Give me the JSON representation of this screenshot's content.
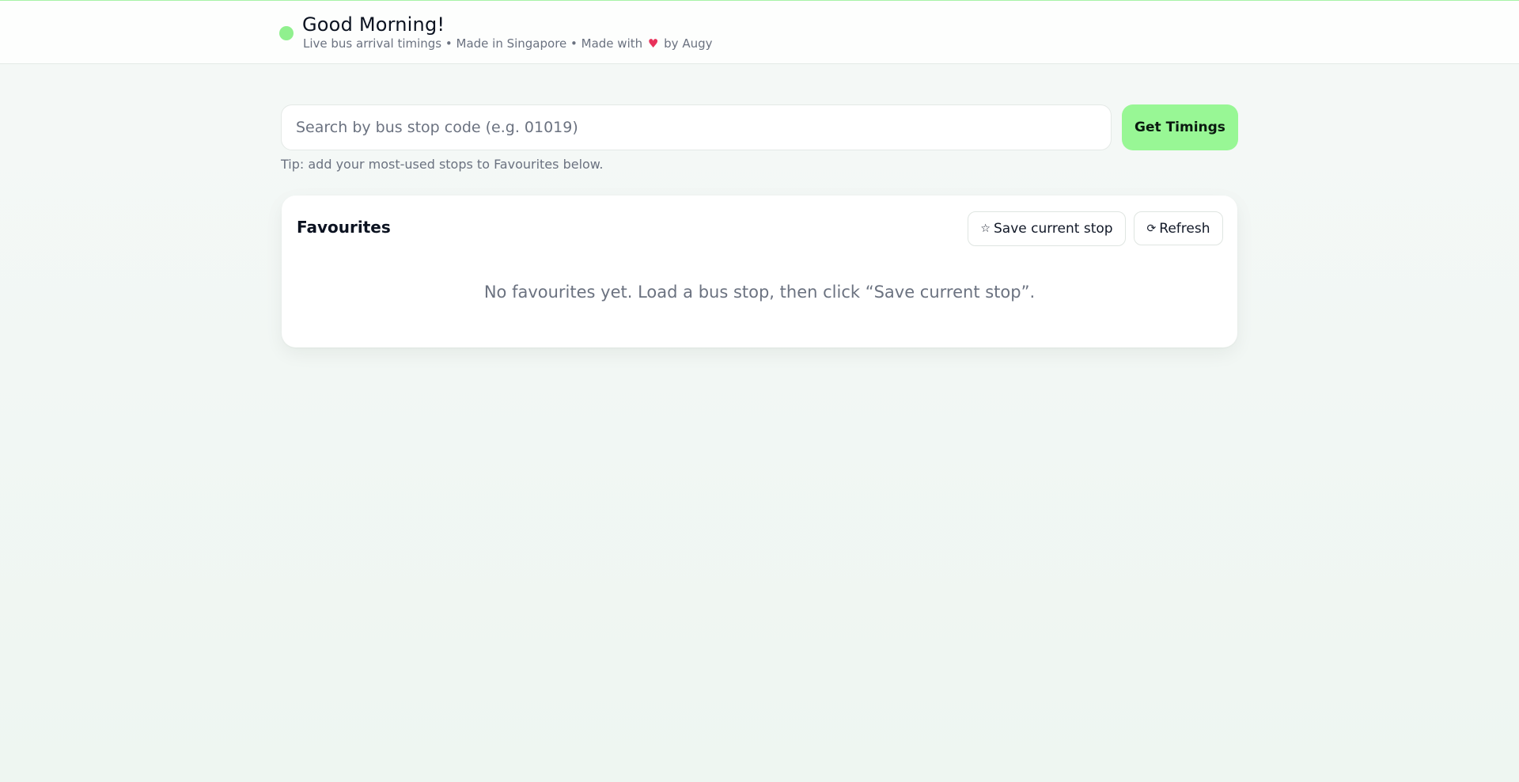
{
  "header": {
    "greeting": "Good Morning!",
    "subtitle_prefix": "Live bus arrival timings • Made in Singapore • Made with",
    "heart": "♥",
    "subtitle_suffix": "by Augy",
    "status_color": "#90f08e"
  },
  "search": {
    "placeholder": "Search by bus stop code (e.g. 01019)",
    "value": "",
    "button_label": "Get Timings",
    "tip": "Tip: add your most-used stops to Favourites below."
  },
  "favourites": {
    "title": "Favourites",
    "save_icon": "☆",
    "save_label": "Save current stop",
    "refresh_icon": "⟳",
    "refresh_label": "Refresh",
    "empty_message": "No favourites yet. Load a bus stop, then click “Save current stop”."
  },
  "colors": {
    "accent": "#98f795",
    "heart": "#e8315a",
    "muted_text": "#6b7280"
  }
}
